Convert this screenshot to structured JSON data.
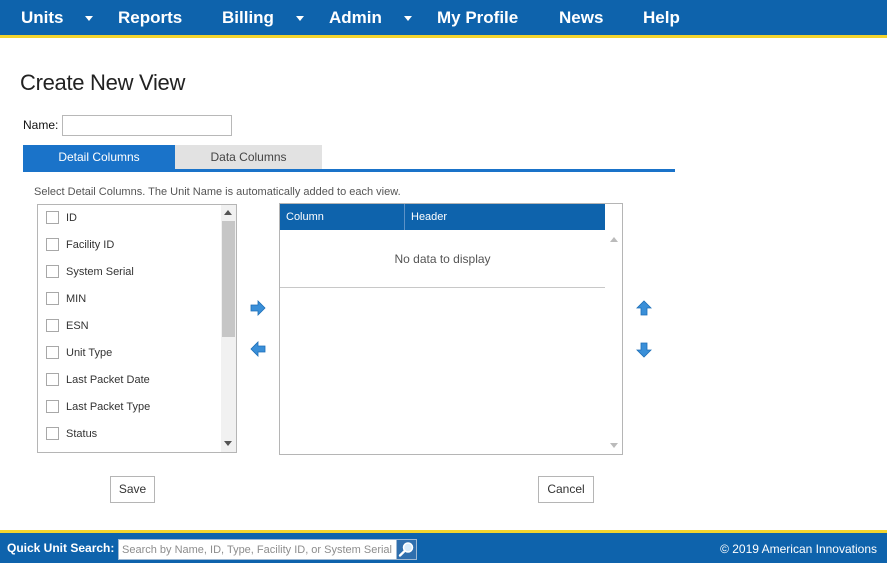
{
  "nav": {
    "units": "Units",
    "reports": "Reports",
    "billing": "Billing",
    "admin": "Admin",
    "my_profile": "My Profile",
    "news": "News",
    "help": "Help"
  },
  "page": {
    "title": "Create New View",
    "name_label": "Name:",
    "name_value": ""
  },
  "tabs": {
    "detail_columns": "Detail Columns",
    "data_columns": "Data Columns",
    "active": "detail_columns"
  },
  "hint": "Select Detail Columns. The Unit Name is automatically added to each view.",
  "available_columns": [
    {
      "label": "ID",
      "checked": false
    },
    {
      "label": "Facility ID",
      "checked": false
    },
    {
      "label": "System Serial",
      "checked": false
    },
    {
      "label": "MIN",
      "checked": false
    },
    {
      "label": "ESN",
      "checked": false
    },
    {
      "label": "Unit Type",
      "checked": false
    },
    {
      "label": "Last Packet Date",
      "checked": false
    },
    {
      "label": "Last Packet Type",
      "checked": false
    },
    {
      "label": "Status",
      "checked": false
    }
  ],
  "grid": {
    "col_column": "Column",
    "col_header": "Header",
    "empty": "No data to display"
  },
  "buttons": {
    "save": "Save",
    "cancel": "Cancel"
  },
  "footer": {
    "quick_search_label": "Quick Unit Search:",
    "quick_search_placeholder": "Search by Name, ID, Type, Facility ID, or System Serial",
    "copyright": "© 2019 American Innovations"
  },
  "colors": {
    "brand_blue": "#0e63ac",
    "accent_yellow": "#f3d42e",
    "tab_blue": "#1a73c9",
    "arrow_blue": "#3a8fd8"
  },
  "icons": {
    "add": "arrow-right-icon",
    "remove": "arrow-left-icon",
    "move_up": "arrow-up-icon",
    "move_down": "arrow-down-icon",
    "search": "magnifier-icon"
  }
}
